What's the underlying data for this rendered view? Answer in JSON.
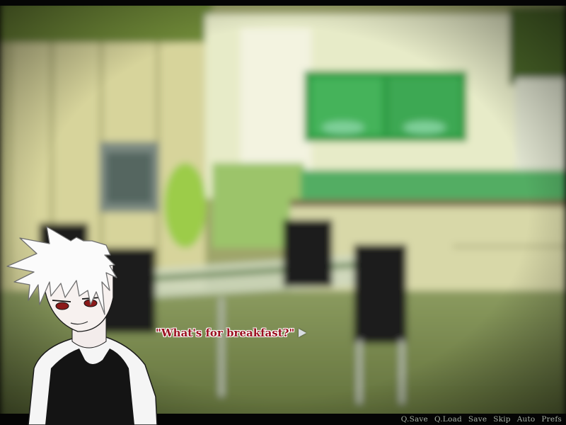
{
  "dialogue": {
    "text": "\"What's for breakfast?\""
  },
  "quick_menu": [
    {
      "label": "Q.Save",
      "name": "qsave-button"
    },
    {
      "label": "Q.Load",
      "name": "qload-button"
    },
    {
      "label": "Save",
      "name": "save-button"
    },
    {
      "label": "Skip",
      "name": "skip-button"
    },
    {
      "label": "Auto",
      "name": "auto-button"
    },
    {
      "label": "Prefs",
      "name": "prefs-button"
    }
  ],
  "colors": {
    "dialogue_text": "#9b1020",
    "menu_text": "#a7b1a5",
    "background_tint": "#7a9a3c",
    "cabinet_green": "#3aa04a"
  },
  "icons": {
    "continue": "continue-arrow-icon"
  }
}
